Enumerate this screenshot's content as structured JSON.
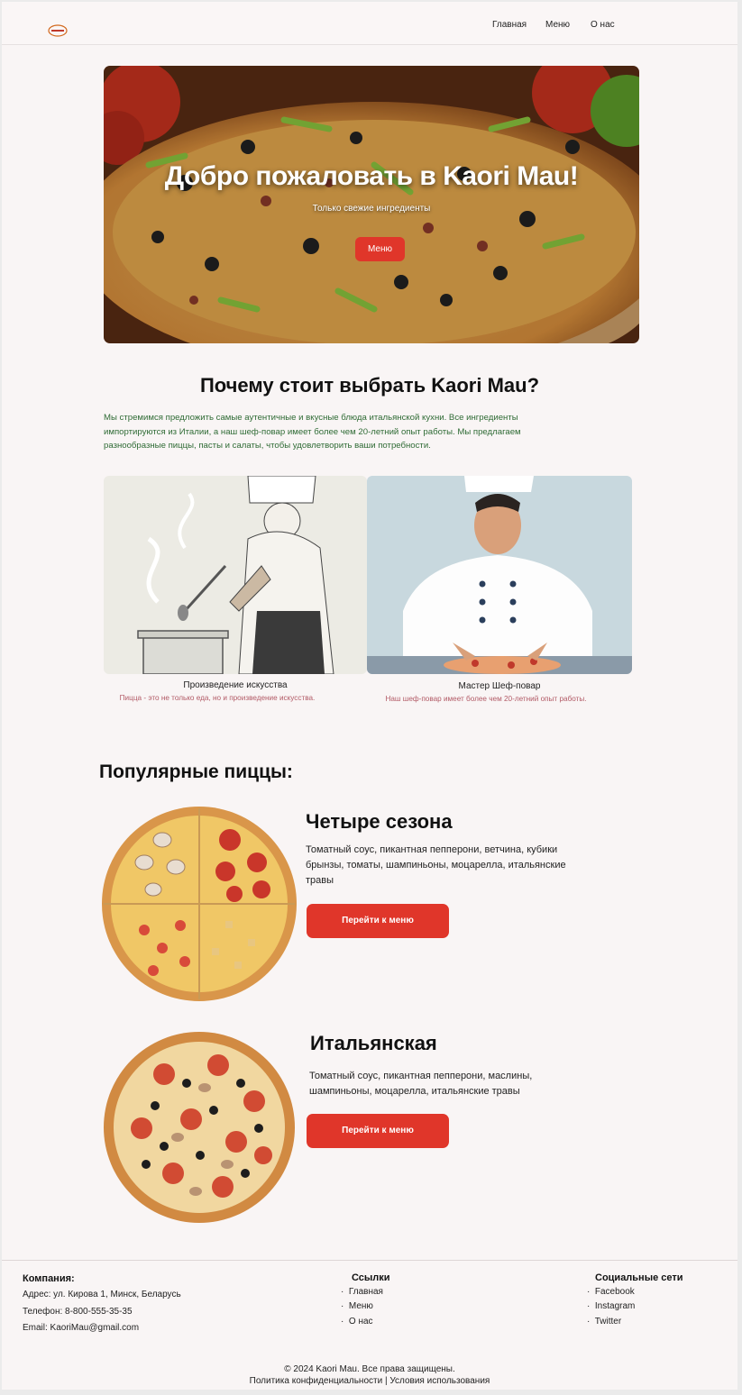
{
  "nav": {
    "items": [
      {
        "label": "Главная"
      },
      {
        "label": "Меню"
      },
      {
        "label": "О нас"
      }
    ]
  },
  "hero": {
    "title": "Добро пожаловать в Kaori Mau!",
    "subtitle": "Только свежие ингредиенты",
    "button": "Меню"
  },
  "why": {
    "title": "Почему стоит выбрать Kaori Mau?",
    "lines": [
      "Мы стремимся предложить самые аутентичные и вкусные блюда итальянской кухни. Все ингредиенты",
      "импортируются из Италии, а наш шеф-повар имеет более чем 20-летний опыт работы. Мы предлагаем",
      "разнообразные пиццы, пасты и салаты, чтобы удовлетворить ваши потребности."
    ]
  },
  "features": [
    {
      "title": "Произведение искусства",
      "text": "Пицца - это не только еда, но и произведение искусства."
    },
    {
      "title": "Мастер Шеф-повар",
      "text": "Наш шеф-повар имеет более чем 20-летний опыт работы."
    }
  ],
  "popular": {
    "title": "Популярные пиццы:",
    "pizzas": [
      {
        "name": "Четыре сезона",
        "desc": [
          "Томатный соус, пикантная пепперони, ветчина, кубики",
          "брынзы, томаты, шампиньоны, моцарелла, итальянские",
          "травы"
        ],
        "button": "Перейти к меню"
      },
      {
        "name": "Итальянская",
        "desc": [
          "Томатный соус, пикантная пепперони, маслины,",
          "шампиньоны, моцарелла, итальянские травы"
        ],
        "button": "Перейти к меню"
      }
    ]
  },
  "footer": {
    "company": {
      "title": "Компания:",
      "address": "Адрес: ул. Кирова 1, Минск, Беларусь",
      "phone": "Телефон: 8-800-555-35-35",
      "email": "Email: KaoriMau@gmail.com"
    },
    "links": {
      "title": "Ссылки",
      "items": [
        "Главная",
        "Меню",
        "О нас"
      ]
    },
    "social": {
      "title": "Социальные сети",
      "items": [
        "Facebook",
        "Instagram",
        "Twitter"
      ]
    },
    "copyright": "© 2024 Kaori Mau. Все права защищены.",
    "legal": "Политика конфиденциальности | Условия использования"
  },
  "colors": {
    "accent": "#e0362a",
    "why_text": "#2f6b35",
    "feature_text": "#b25a66",
    "background": "#f9f5f5"
  }
}
